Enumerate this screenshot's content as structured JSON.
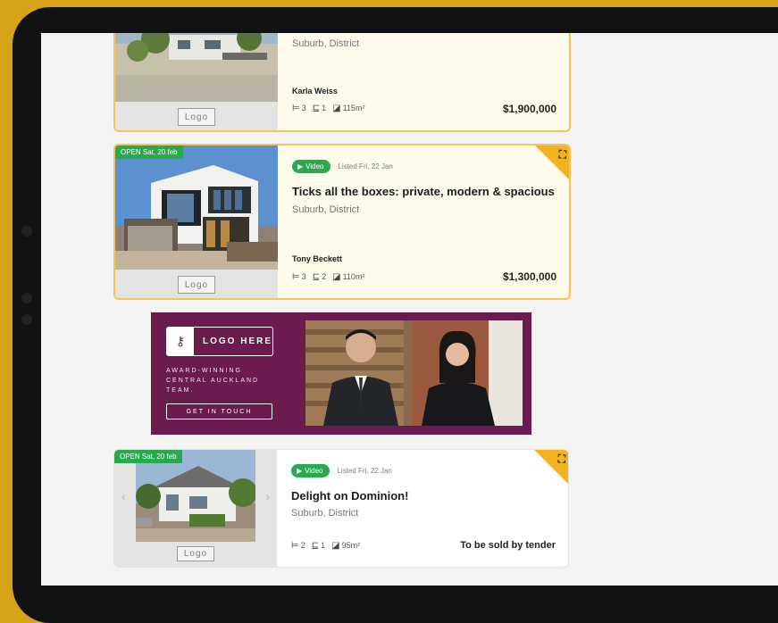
{
  "listings": [
    {
      "open": "",
      "video": "",
      "listed": "",
      "title": "",
      "suburb": "Suburb, District",
      "agent": "Karla Weiss",
      "beds": "3",
      "baths": "1",
      "area": "115m²",
      "price": "$1,900,000",
      "logo": "Logo"
    },
    {
      "open": "OPEN Sat, 20 feb",
      "video": "Video",
      "listed": "Listed Fri, 22 Jan",
      "title": "Ticks all the boxes: private, modern & spacious",
      "suburb": "Suburb, District",
      "agent": "Tony Beckett",
      "beds": "3",
      "baths": "2",
      "area": "110m²",
      "price": "$1,300,000",
      "logo": "Logo"
    },
    {
      "open": "OPEN Sat, 20 feb",
      "video": "Video",
      "listed": "Listed Fri, 22 Jan",
      "title": "Delight on Dominion!",
      "suburb": "Suburb, District",
      "agent": "",
      "beds": "2",
      "baths": "1",
      "area": "95m²",
      "price": "To be sold by tender",
      "logo": "Logo"
    }
  ],
  "ad": {
    "logo_text": "LOGO HERE",
    "tagline": "AWARD-WINNING CENTRAL AUCKLAND TEAM.",
    "cta": "GET IN TOUCH"
  },
  "icons": {
    "bed": "bed-icon",
    "bath": "bath-icon",
    "area": "floor-area-icon",
    "play": "play-icon",
    "shortlist": "premium-badge-icon",
    "key": "key-icon"
  },
  "colors": {
    "featured_bg": "#fffbea",
    "featured_border": "#f3c65b",
    "open_badge": "#2aa84e",
    "ad_bg": "#6b1b4e",
    "page_bg": "#d7a417"
  }
}
